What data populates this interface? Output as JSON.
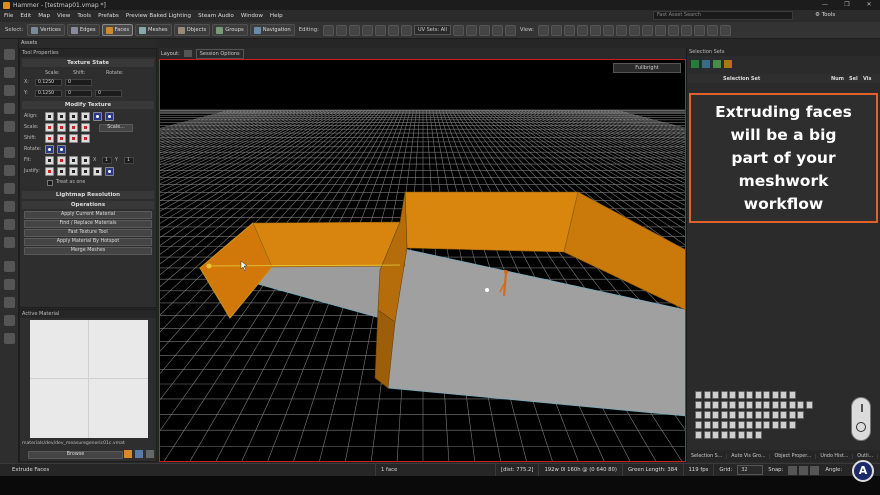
{
  "window": {
    "title": "Hammer - [testmap01.vmap *]",
    "controls": [
      "—",
      "❐",
      "✕"
    ]
  },
  "menu": [
    "File",
    "Edit",
    "Map",
    "View",
    "Tools",
    "Prefabs",
    "Preview Baked Lighting",
    "Steam Audio",
    "Window",
    "Help"
  ],
  "asset_search": {
    "placeholder": "Fast Asset Search"
  },
  "tools_menu": "Tools",
  "toolbar": {
    "select_label": "Select:",
    "modes": [
      "Vertices",
      "Edges",
      "Faces",
      "Meshes",
      "Objects",
      "Groups",
      "Navigation"
    ],
    "active_mode": "Faces",
    "editing_label": "Editing:",
    "uv_sets": "UV Sets: All",
    "view_label": "View:"
  },
  "assets_title": "Assets",
  "tool_properties": {
    "title": "Tool Properties",
    "texture_state": {
      "title": "Texture State",
      "col_scale": "Scale:",
      "col_shift": "Shift:",
      "col_rotate": "Rotate:",
      "x_label": "X:",
      "y_label": "Y:",
      "x_scale": "0.1250",
      "x_shift": "0",
      "y_scale": "0.1250",
      "y_shift": "0",
      "rotate": "0"
    },
    "modify_texture": {
      "title": "Modify Texture",
      "align": "Align:",
      "scale": "Scale:",
      "shift": "Shift:",
      "rotate": "Rotate:",
      "fit": "Fit:",
      "justify": "Justify:",
      "scale_btn": "Scale...",
      "fit_x": "X",
      "fit_y": "Y",
      "fit_values": [
        "1",
        "1"
      ],
      "treat_as_one": "Treat as one"
    },
    "lightmap_resolution": "Lightmap Resolution",
    "operations": {
      "title": "Operations",
      "buttons": [
        "Apply Current Material",
        "Find / Replace Materials",
        "Fast Texture Tool",
        "Apply Material By Hotspot",
        "Merge Meshes"
      ]
    }
  },
  "active_material": {
    "title": "Active Material",
    "path": "materials/dev/dev_measuregeneric01c.vmat",
    "browse": "Browse"
  },
  "viewport": {
    "layout_label": "Layout:",
    "session_options": "Session Options",
    "render_mode": "Fullbright"
  },
  "selection_sets": {
    "title": "Selection Sets",
    "columns": [
      "Selection Set",
      "Num",
      "Sel",
      "Vis"
    ]
  },
  "callout": {
    "lines": [
      "Extruding faces",
      "will be a big",
      "part of your",
      "meshwork",
      "workflow"
    ],
    "border_color": "#e0622a"
  },
  "right_tabs": [
    "Selection S...",
    "Auto Vis Gro...",
    "Object Proper...",
    "Undo Hist...",
    "Outli..."
  ],
  "status": {
    "tool": "Extrude Faces",
    "selection": "1 face",
    "dist": "[dist: 775.2]",
    "dims": "192w 0l 160h @ (0 640 80)",
    "green_length": "Green Length: 384",
    "fps": "119 fps",
    "grid_label": "Grid:",
    "grid_value": "32",
    "snap_label": "Snap:",
    "angle_label": "Angle:"
  },
  "colors": {
    "face_orange": "#d2780a",
    "floor_grey": "#9c9c9c",
    "accent": "#e0622a"
  }
}
